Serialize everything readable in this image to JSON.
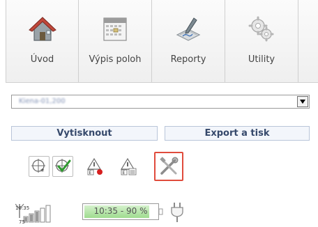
{
  "nav": {
    "items": [
      {
        "label": "Úvod",
        "icon": "home-icon"
      },
      {
        "label": "Výpis poloh",
        "icon": "calendar-icon"
      },
      {
        "label": "Reporty",
        "icon": "report-pen-icon"
      },
      {
        "label": "Utility",
        "icon": "gears-icon"
      }
    ]
  },
  "select": {
    "value": "Kiena-01,200"
  },
  "buttons": {
    "print_label": "Vytisknout",
    "export_label": "Export a tisk"
  },
  "tools": [
    {
      "icon": "target-star-icon"
    },
    {
      "icon": "target-check-icon"
    },
    {
      "icon": "warning-record-icon"
    },
    {
      "icon": "warning-list-icon"
    },
    {
      "icon": "tools-crossed-icon",
      "selected": true
    }
  ],
  "status": {
    "signal_time": "10:35",
    "signal_level": "75",
    "battery_label": "10:35 - 90 %",
    "battery_level": 0.9,
    "accent_green": "#9fdc8f",
    "selection_color": "#e04b3c"
  }
}
